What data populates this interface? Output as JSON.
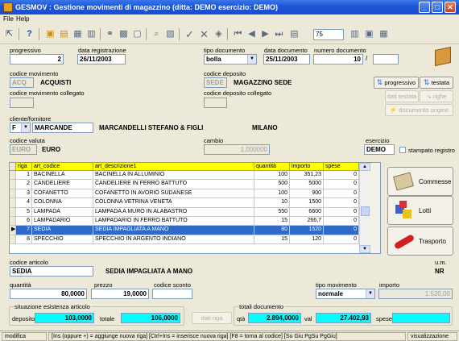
{
  "window": {
    "title": "GESMOV : Gestione movimenti di magazzino   (ditta: DEMO  esercizio: DEMO)"
  },
  "menu": {
    "file": "File",
    "help": "Help"
  },
  "toolbar": {
    "page_value": "75"
  },
  "header": {
    "progressivo_label": "progressivo",
    "progressivo": "2",
    "data_reg_label": "data registrazione",
    "data_reg": "26/11/2003",
    "tipo_doc_label": "tipo documento",
    "tipo_doc": "bolla",
    "data_doc_label": "data documento",
    "data_doc": "25/11/2003",
    "num_doc_label": "numero documento",
    "num_doc": "10",
    "num_doc_sep": "/",
    "cod_mov_label": "codice movimento",
    "cod_mov": "ACQ",
    "cod_mov_desc": "ACQUISTI",
    "cod_dep_label": "codice deposito",
    "cod_dep": "SEDE",
    "cod_dep_desc": "MAGAZZINO SEDE",
    "cod_mov_coll_label": "codice movimento collegato",
    "cod_dep_coll_label": "codice deposito collegato",
    "cliente_label": "cliente/fornitore",
    "cliente_tipo": "F",
    "cliente_cod": "MARCANDE",
    "cliente_nome": "MARCANDELLI STEFANO & FIGLI",
    "cliente_citta": "MILANO",
    "valuta_label": "codice valuta",
    "valuta": "EURO",
    "valuta_desc": "EURO",
    "cambio_label": "cambio",
    "cambio": "1,000000",
    "esercizio_label": "esercizio",
    "esercizio": "DEMO",
    "stampato_label": "stampato registro"
  },
  "buttons": {
    "progressivo": "progressivo",
    "testata": "testata",
    "dati_testata": "dati testata",
    "righe": "righe",
    "documento_origine": "documento origine",
    "commesse": "Commesse",
    "lotti": "Lotti",
    "trasporto": "Trasporto",
    "dati_riga": "dati riga"
  },
  "grid": {
    "headers": [
      "riga",
      "art_codice",
      "art_descrizione1",
      "quantità",
      "importo",
      "spese"
    ],
    "rows": [
      [
        "1",
        "BACINELLA",
        "BACINELLA IN ALLUMINIO",
        "100",
        "351,23",
        "0"
      ],
      [
        "2",
        "CANDELIERE",
        "CANDELIERE IN FERRO BATTUTO",
        "500",
        "5000",
        "0"
      ],
      [
        "3",
        "COFANETTO",
        "COFANETTO IN AVORIO SUDANESE",
        "100",
        "900",
        "0"
      ],
      [
        "4",
        "COLONNA",
        "COLONNA VETRINA VENETA",
        "10",
        "1500",
        "0"
      ],
      [
        "5",
        "LAMPADA",
        "LAMPADA A MURO IN ALABASTRO",
        "550",
        "6600",
        "0"
      ],
      [
        "6",
        "LAMPADARIO",
        "LAMPADARIO IN FERRO BATTUTO",
        "15",
        "266,7",
        "0"
      ],
      [
        "7",
        "SEDIA",
        "SEDIA IMPAGLIATA A MANO",
        "80",
        "1520",
        "0"
      ],
      [
        "8",
        "SPECCHIO",
        "SPECCHIO IN ARGENTO INDIANO",
        "15",
        "120",
        "0"
      ]
    ],
    "selected_row": 6
  },
  "detail": {
    "cod_art_label": "codice articolo",
    "cod_art": "SEDIA",
    "cod_art_desc": "SEDIA IMPAGLIATA A MANO",
    "um_label": "u.m.",
    "um": "NR",
    "quantita_label": "quantità",
    "quantita": "80,0000",
    "prezzo_label": "prezzo",
    "prezzo": "19,0000",
    "sconto_label": "codice sconto",
    "tipo_mov_label": "tipo movimento",
    "tipo_mov": "normale",
    "importo_label": "importo",
    "importo": "1.520,00"
  },
  "esistenza": {
    "title": "situazione esistenza articolo",
    "deposito_label": "deposito",
    "deposito": "103,0000",
    "totale_label": "totale",
    "totale": "106,0000"
  },
  "totali": {
    "title": "totali documento",
    "qta_label": "qtà",
    "qta": "2.894,0000",
    "val_label": "val",
    "val": "27.402,93",
    "spese_label": "spese",
    "spese": ""
  },
  "status": {
    "mode": "modifica",
    "hint": "[Ins (oppure +) = aggiunge nuova riga] [Ctrl+Ins = inserisce nuova riga] [F8 = torna al codice] [Su Giu PgSu PgGiu]",
    "state": "visualizzazione"
  },
  "colors": {
    "accent": "#3169c6",
    "grid_header": "#ffff00",
    "highlight": "#00ffff"
  }
}
